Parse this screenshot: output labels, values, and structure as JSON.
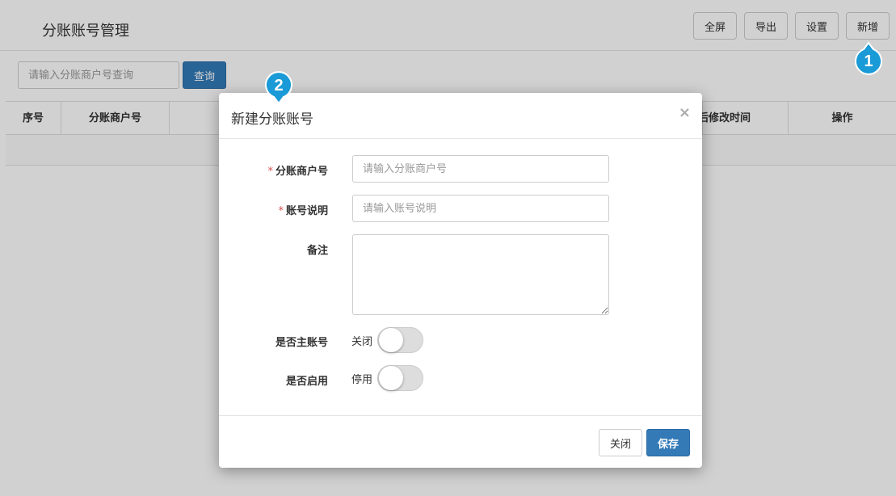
{
  "page": {
    "title": "分账账号管理",
    "toolbar": {
      "fullscreen": "全屏",
      "export": "导出",
      "settings": "设置",
      "add": "新增"
    },
    "search": {
      "placeholder": "请输入分账商户号查询",
      "button": "查询"
    },
    "table": {
      "columns": [
        "序号",
        "分账商户号",
        "后修改时间",
        "操作"
      ]
    }
  },
  "modal": {
    "title": "新建分账账号",
    "close_symbol": "×",
    "fields": {
      "merchant": {
        "required_mark": "*",
        "label": "分账商户号",
        "placeholder": "请输入分账商户号",
        "value": ""
      },
      "description": {
        "required_mark": "*",
        "label": "账号说明",
        "placeholder": "请输入账号说明",
        "value": ""
      },
      "remark": {
        "label": "备注",
        "value": ""
      },
      "is_main": {
        "label": "是否主账号",
        "state_text": "关闭",
        "on": false
      },
      "is_enabled": {
        "label": "是否启用",
        "state_text": "停用",
        "on": false
      }
    },
    "footer": {
      "close": "关闭",
      "save": "保存"
    }
  },
  "markers": [
    {
      "number": "1",
      "color": "#1a9ad6"
    },
    {
      "number": "2",
      "color": "#1a9ad6"
    }
  ]
}
